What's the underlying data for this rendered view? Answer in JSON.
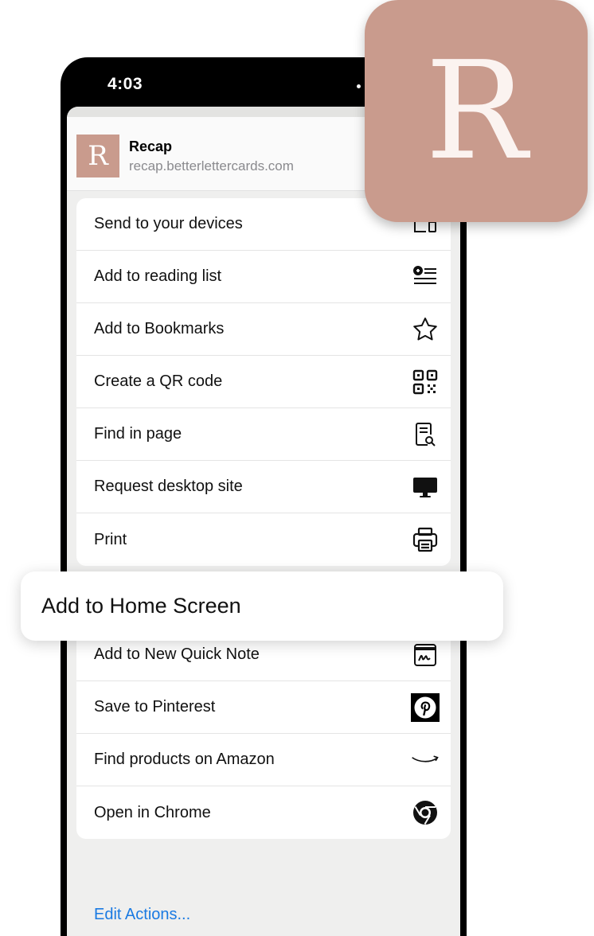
{
  "status_bar": {
    "time": "4:03"
  },
  "site": {
    "title": "Recap",
    "url": "recap.betterlettercards.com",
    "favicon_letter": "R"
  },
  "actions": [
    {
      "label": "Send to your devices",
      "icon": "devices-icon"
    },
    {
      "label": "Add to reading list",
      "icon": "reading-list-icon"
    },
    {
      "label": "Add to Bookmarks",
      "icon": "star-icon"
    },
    {
      "label": "Create a QR code",
      "icon": "qr-code-icon"
    },
    {
      "label": "Find in page",
      "icon": "find-in-page-icon"
    },
    {
      "label": "Request desktop site",
      "icon": "desktop-icon"
    },
    {
      "label": "Print",
      "icon": "printer-icon"
    }
  ],
  "more_actions": [
    {
      "label": "Add to New Quick Note",
      "icon": "quick-note-icon"
    },
    {
      "label": "Save to Pinterest",
      "icon": "pinterest-icon"
    },
    {
      "label": "Find products on Amazon",
      "icon": "amazon-icon"
    },
    {
      "label": "Open in Chrome",
      "icon": "chrome-icon"
    }
  ],
  "edit_actions_label": "Edit Actions...",
  "highlight": {
    "label": "Add to Home Screen"
  },
  "app_icon": {
    "letter": "R"
  },
  "colors": {
    "brand": "#c99b8d",
    "link": "#1a7ae2",
    "background": "#efefee"
  }
}
